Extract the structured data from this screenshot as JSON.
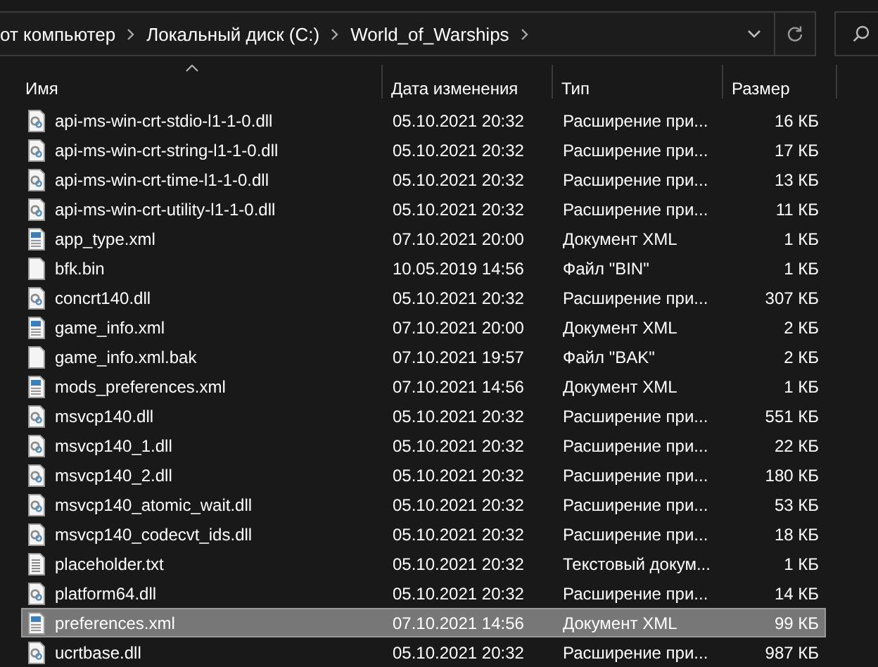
{
  "address": {
    "crumbs": [
      "от компьютер",
      "Локальный диск (C:)",
      "World_of_Warships"
    ]
  },
  "columns": [
    {
      "label": "Имя",
      "sorted": true
    },
    {
      "label": "Дата изменения",
      "sorted": false
    },
    {
      "label": "Тип",
      "sorted": false
    },
    {
      "label": "Размер",
      "sorted": false
    }
  ],
  "rows": [
    {
      "kind": "dll",
      "name": "api-ms-win-crt-stdio-l1-1-0.dll",
      "date": "05.10.2021 20:32",
      "type": "Расширение при...",
      "size": "16 КБ",
      "selected": false
    },
    {
      "kind": "dll",
      "name": "api-ms-win-crt-string-l1-1-0.dll",
      "date": "05.10.2021 20:32",
      "type": "Расширение при...",
      "size": "17 КБ",
      "selected": false
    },
    {
      "kind": "dll",
      "name": "api-ms-win-crt-time-l1-1-0.dll",
      "date": "05.10.2021 20:32",
      "type": "Расширение при...",
      "size": "13 КБ",
      "selected": false
    },
    {
      "kind": "dll",
      "name": "api-ms-win-crt-utility-l1-1-0.dll",
      "date": "05.10.2021 20:32",
      "type": "Расширение при...",
      "size": "11 КБ",
      "selected": false
    },
    {
      "kind": "xml",
      "name": "app_type.xml",
      "date": "07.10.2021 20:00",
      "type": "Документ XML",
      "size": "1 КБ",
      "selected": false
    },
    {
      "kind": "file",
      "name": "bfk.bin",
      "date": "10.05.2019 14:56",
      "type": "Файл \"BIN\"",
      "size": "1 КБ",
      "selected": false
    },
    {
      "kind": "dll",
      "name": "concrt140.dll",
      "date": "05.10.2021 20:32",
      "type": "Расширение при...",
      "size": "307 КБ",
      "selected": false
    },
    {
      "kind": "xml",
      "name": "game_info.xml",
      "date": "07.10.2021 20:00",
      "type": "Документ XML",
      "size": "2 КБ",
      "selected": false
    },
    {
      "kind": "file",
      "name": "game_info.xml.bak",
      "date": "07.10.2021 19:57",
      "type": "Файл \"BAK\"",
      "size": "2 КБ",
      "selected": false
    },
    {
      "kind": "xml",
      "name": "mods_preferences.xml",
      "date": "07.10.2021 14:56",
      "type": "Документ XML",
      "size": "1 КБ",
      "selected": false
    },
    {
      "kind": "dll",
      "name": "msvcp140.dll",
      "date": "05.10.2021 20:32",
      "type": "Расширение при...",
      "size": "551 КБ",
      "selected": false
    },
    {
      "kind": "dll",
      "name": "msvcp140_1.dll",
      "date": "05.10.2021 20:32",
      "type": "Расширение при...",
      "size": "22 КБ",
      "selected": false
    },
    {
      "kind": "dll",
      "name": "msvcp140_2.dll",
      "date": "05.10.2021 20:32",
      "type": "Расширение при...",
      "size": "180 КБ",
      "selected": false
    },
    {
      "kind": "dll",
      "name": "msvcp140_atomic_wait.dll",
      "date": "05.10.2021 20:32",
      "type": "Расширение при...",
      "size": "53 КБ",
      "selected": false
    },
    {
      "kind": "dll",
      "name": "msvcp140_codecvt_ids.dll",
      "date": "05.10.2021 20:32",
      "type": "Расширение при...",
      "size": "18 КБ",
      "selected": false
    },
    {
      "kind": "txt",
      "name": "placeholder.txt",
      "date": "05.10.2021 20:32",
      "type": "Текстовый докум...",
      "size": "1 КБ",
      "selected": false
    },
    {
      "kind": "dll",
      "name": "platform64.dll",
      "date": "05.10.2021 20:32",
      "type": "Расширение при...",
      "size": "14 КБ",
      "selected": false
    },
    {
      "kind": "xml",
      "name": "preferences.xml",
      "date": "07.10.2021 14:56",
      "type": "Документ XML",
      "size": "99 КБ",
      "selected": true
    },
    {
      "kind": "dll",
      "name": "ucrtbase.dll",
      "date": "05.10.2021 20:32",
      "type": "Расширение при...",
      "size": "987 КБ",
      "selected": false
    }
  ]
}
